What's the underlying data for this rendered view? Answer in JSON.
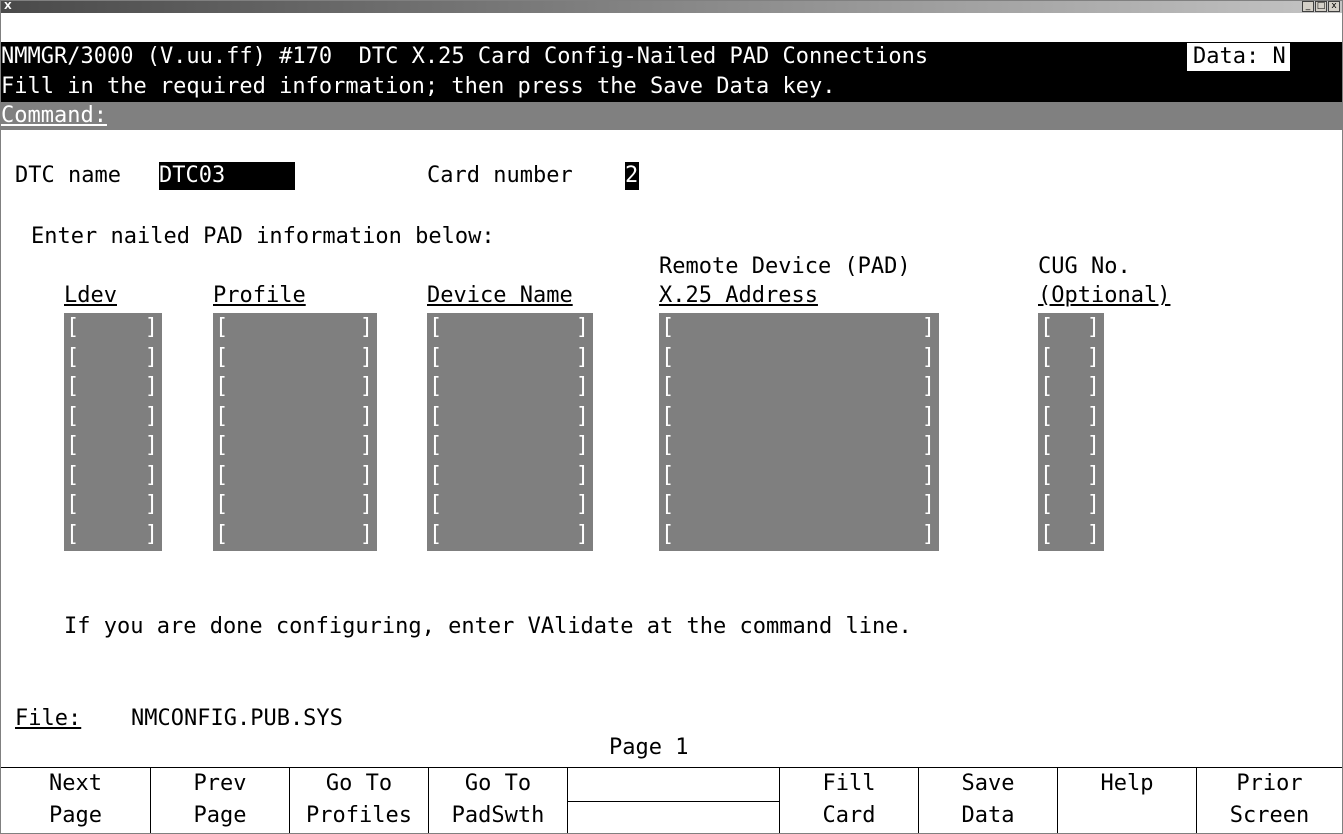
{
  "window": {
    "icon": "X",
    "buttons": [
      "_",
      "□",
      "x"
    ]
  },
  "header": {
    "title": "NMMGR/3000 (V.uu.ff) #170  DTC X.25 Card Config-Nailed PAD Connections",
    "data_flag": "Data: N",
    "instruction": "Fill in the required information; then press the Save Data key.",
    "command_label": "Command:"
  },
  "form": {
    "dtc_name_label": "DTC name",
    "dtc_name_value": "DTC03",
    "card_number_label": "Card number",
    "card_number_value": "2",
    "section_label": "Enter nailed PAD information below:",
    "columns": {
      "ldev": "Ldev",
      "profile": "Profile",
      "device_name": "Device Name",
      "remote_line1": "Remote Device (PAD)",
      "remote_line2": "X.25 Address",
      "cug_line1": "CUG No.",
      "cug_line2": "(Optional)"
    },
    "bracket_open": "[",
    "bracket_close": "]",
    "row_count": 8
  },
  "footer": {
    "validate_hint": "If you are done configuring, enter VAlidate at the command line.",
    "file_label": "File:",
    "file_value": "NMCONFIG.PUB.SYS",
    "page": "Page 1"
  },
  "function_keys": [
    {
      "line1": "Next",
      "line2": "Page"
    },
    {
      "line1": "Prev",
      "line2": "Page"
    },
    {
      "line1": "Go To",
      "line2": "Profiles"
    },
    {
      "line1": "Go To",
      "line2": "PadSwth"
    },
    {
      "line1": "",
      "line2": ""
    },
    {
      "line1": "Fill",
      "line2": "Card"
    },
    {
      "line1": "Save",
      "line2": "Data"
    },
    {
      "line1": "Help",
      "line2": ""
    },
    {
      "line1": "Prior",
      "line2": "Screen"
    }
  ]
}
